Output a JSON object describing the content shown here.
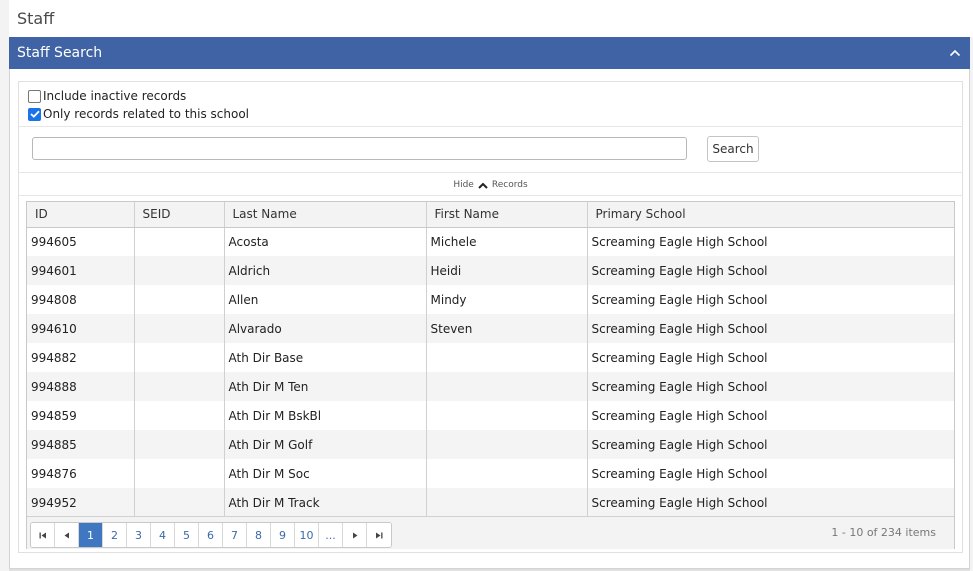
{
  "page": {
    "title": "Staff"
  },
  "panel": {
    "title": "Staff Search"
  },
  "options": {
    "include_inactive": {
      "label": "Include inactive records",
      "checked": false
    },
    "only_related": {
      "label": "Only records related to this school",
      "checked": true
    }
  },
  "search": {
    "value": "",
    "placeholder": "",
    "button_label": "Search"
  },
  "toggle": {
    "hide_label": "Hide",
    "records_label": "Records"
  },
  "grid": {
    "columns": [
      "ID",
      "SEID",
      "Last Name",
      "First Name",
      "Primary School"
    ],
    "rows": [
      [
        "994605",
        "",
        "Acosta",
        "Michele",
        "Screaming Eagle High School"
      ],
      [
        "994601",
        "",
        "Aldrich",
        "Heidi",
        "Screaming Eagle High School"
      ],
      [
        "994808",
        "",
        "Allen",
        "Mindy",
        "Screaming Eagle High School"
      ],
      [
        "994610",
        "",
        "Alvarado",
        "Steven",
        "Screaming Eagle High School"
      ],
      [
        "994882",
        "",
        "Ath Dir Base",
        "",
        "Screaming Eagle High School"
      ],
      [
        "994888",
        "",
        "Ath Dir M Ten",
        "",
        "Screaming Eagle High School"
      ],
      [
        "994859",
        "",
        "Ath Dir M BskBl",
        "",
        "Screaming Eagle High School"
      ],
      [
        "994885",
        "",
        "Ath Dir M Golf",
        "",
        "Screaming Eagle High School"
      ],
      [
        "994876",
        "",
        "Ath Dir M Soc",
        "",
        "Screaming Eagle High School"
      ],
      [
        "994952",
        "",
        "Ath Dir M Track",
        "",
        "Screaming Eagle High School"
      ]
    ]
  },
  "pager": {
    "pages": [
      "1",
      "2",
      "3",
      "4",
      "5",
      "6",
      "7",
      "8",
      "9",
      "10",
      "..."
    ],
    "current": "1",
    "info": "1 - 10 of 234 items"
  },
  "colors": {
    "header_bar": "#3f63a4",
    "active_page": "#3f78c0",
    "checkbox_checked": "#1a73e8"
  }
}
